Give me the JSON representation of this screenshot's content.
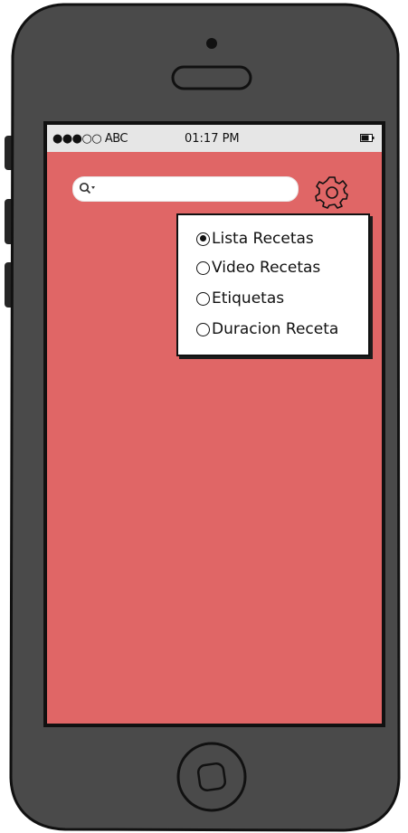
{
  "status_bar": {
    "signal": "●●●○○ ABC",
    "time": "01:17 PM"
  },
  "search": {
    "placeholder": ""
  },
  "menu": {
    "options": [
      {
        "label": "Lista Recetas",
        "selected": true
      },
      {
        "label": "Video Recetas",
        "selected": false
      },
      {
        "label": "Etiquetas",
        "selected": false
      },
      {
        "label": "Duracion Receta",
        "selected": false
      }
    ]
  },
  "colors": {
    "screen_background": "#e06666",
    "phone_body": "#4a4a4a",
    "status_bar": "#e6e6e6"
  },
  "icons": {
    "search": "search-icon",
    "settings": "gear-icon",
    "battery": "battery-icon",
    "home": "home-button-icon"
  }
}
